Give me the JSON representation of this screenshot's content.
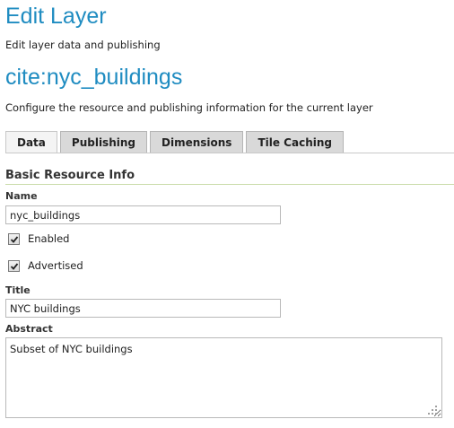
{
  "header": {
    "title": "Edit Layer",
    "description": "Edit layer data and publishing"
  },
  "layer": {
    "name": "cite:nyc_buildings",
    "description": "Configure the resource and publishing information for the current layer"
  },
  "tabs": [
    {
      "label": "Data",
      "active": true
    },
    {
      "label": "Publishing",
      "active": false
    },
    {
      "label": "Dimensions",
      "active": false
    },
    {
      "label": "Tile Caching",
      "active": false
    }
  ],
  "section": {
    "title": "Basic Resource Info"
  },
  "form": {
    "name_label": "Name",
    "name_value": "nyc_buildings",
    "enabled_label": "Enabled",
    "enabled_checked": true,
    "advertised_label": "Advertised",
    "advertised_checked": true,
    "title_label": "Title",
    "title_value": "NYC buildings",
    "abstract_label": "Abstract",
    "abstract_value": "Subset of NYC buildings"
  },
  "colors": {
    "heading": "#1f8cc1",
    "section_rule": "#c9dcaa",
    "tab_bg": "#d9d9d9",
    "tab_active_bg": "#f4f4f4"
  }
}
